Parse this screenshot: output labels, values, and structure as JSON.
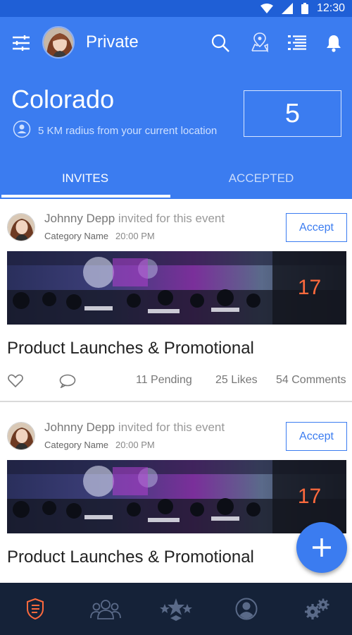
{
  "status_bar": {
    "time": "12:30"
  },
  "header": {
    "privacy_label": "Private",
    "location": {
      "city": "Colorado",
      "radius_text": "5 KM radius from your current location"
    },
    "count": "5",
    "tabs": [
      {
        "label": "INVITES",
        "active": true
      },
      {
        "label": "ACCEPTED",
        "active": false
      }
    ]
  },
  "feed": {
    "cards": [
      {
        "inviter_name": "Johnny Depp",
        "invite_text": "invited for this event",
        "category": "Category Name",
        "time": "20:00 PM",
        "accept_label": "Accept",
        "date_day": "17",
        "title": "Product Launches & Promotional",
        "pending": "11 Pending",
        "likes": "25 Likes",
        "comments": "54 Comments"
      },
      {
        "inviter_name": "Johnny Depp",
        "invite_text": "invited for this event",
        "category": "Category Name",
        "time": "20:00 PM",
        "accept_label": "Accept",
        "date_day": "17",
        "title": "Product Launches & Promotional"
      }
    ]
  },
  "icons": {
    "top_left": "filter-sliders-icon",
    "search": "search-icon",
    "map": "map-pin-icon",
    "list": "list-icon",
    "notifications": "bell-icon",
    "location": "location-person-icon",
    "like": "heart-icon",
    "comment": "comment-icon",
    "fab": "plus-icon",
    "nav": [
      "events-list-icon",
      "groups-icon",
      "stars-icon",
      "profile-icon",
      "settings-icon"
    ]
  },
  "colors": {
    "header_bg": "#3b7cf0",
    "status_bar_bg": "#1f5fd6",
    "accent": "#3b7cf0",
    "date_badge_text": "#ff6a3d",
    "bottom_nav_bg": "#152238",
    "nav_active": "#ff6a3d",
    "nav_inactive": "#5a6a88"
  }
}
